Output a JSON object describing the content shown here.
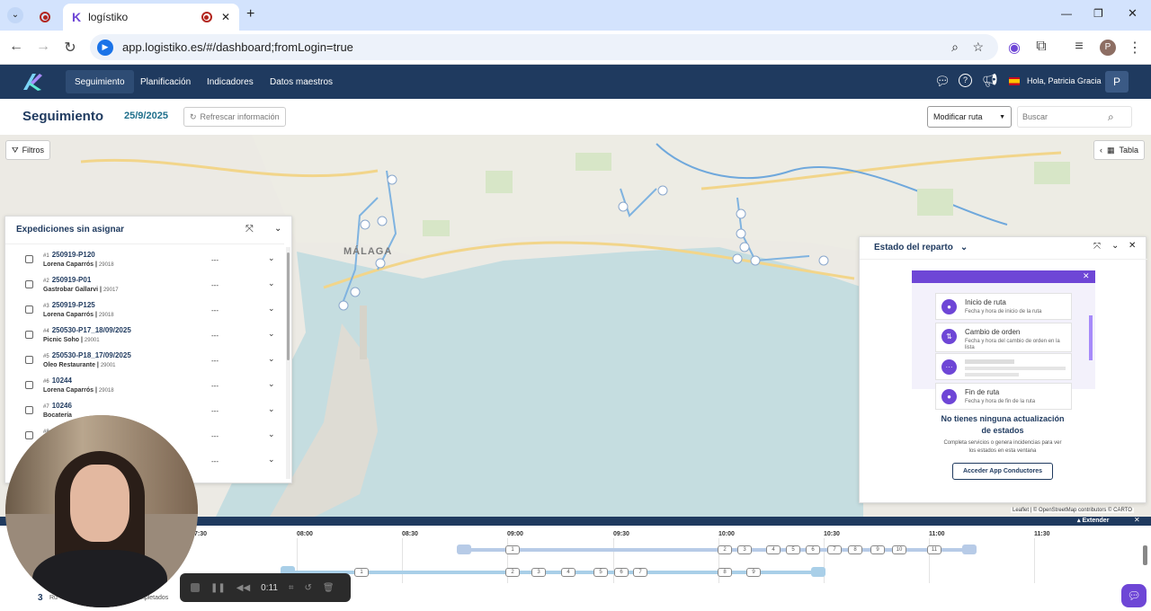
{
  "browser": {
    "tab_title": "logístiko",
    "url": "app.logistiko.es/#/dashboard;fromLogin=true"
  },
  "nav": {
    "items": [
      "Seguimiento",
      "Planificación",
      "Indicadores",
      "Datos maestros"
    ],
    "greeting": "Hola, Patricia Gracia",
    "avatar": "P"
  },
  "header": {
    "title": "Seguimiento",
    "date": "25/9/2025",
    "refresh_label": "Refrescar información",
    "route_select": "Modificar ruta",
    "search_placeholder": "Buscar"
  },
  "map": {
    "filters_label": "Filtros",
    "table_label": "Tabla",
    "city_label": "MÁLAGA",
    "attribution": "Leaflet | © OpenStreetMap contributors © CARTO"
  },
  "unassigned": {
    "title": "Expediciones sin asignar",
    "rows": [
      {
        "num": "#1",
        "code": "250919-P120",
        "name": "Lorena Caparrós",
        "zip": "29018",
        "value": "---"
      },
      {
        "num": "#2",
        "code": "250919-P01",
        "name": "Gastrobar Gallarvi",
        "zip": "29017",
        "value": "---"
      },
      {
        "num": "#3",
        "code": "250919-P125",
        "name": "Lorena Caparrós",
        "zip": "29018",
        "value": "---"
      },
      {
        "num": "#4",
        "code": "250530-P17_18/09/2025",
        "name": "Picnic Soho",
        "zip": "29001",
        "value": "---"
      },
      {
        "num": "#5",
        "code": "250530-P18_17/09/2025",
        "name": "Oleo Restaurante",
        "zip": "29001",
        "value": "---"
      },
      {
        "num": "#6",
        "code": "10244",
        "name": "Lorena Caparrós",
        "zip": "29018",
        "value": "---"
      },
      {
        "num": "#7",
        "code": "10246",
        "name": "Bocatería",
        "zip": "",
        "value": "---"
      },
      {
        "num": "#8",
        "code": "",
        "name": "",
        "zip": "",
        "value": "---"
      },
      {
        "num": "",
        "code": "",
        "name": "",
        "zip": "",
        "value": "---"
      }
    ]
  },
  "status_panel": {
    "title": "Estado del reparto",
    "states": [
      {
        "title": "Inicio de ruta",
        "desc": "Fecha y hora de inicio de la ruta"
      },
      {
        "title": "Cambio de orden",
        "desc": "Fecha y hora del cambio de orden en la lista"
      },
      {
        "title": "",
        "desc": ""
      },
      {
        "title": "Fin de ruta",
        "desc": "Fecha y hora de fin de la ruta"
      }
    ],
    "empty_title": "No tienes ninguna actualización de estados",
    "empty_desc": "Completa servicios o genera incidencias para ver los estados en esta ventana",
    "cta": "Acceder App Conductores"
  },
  "timeline": {
    "extend_label": "Extender",
    "ticks": [
      "7:30",
      "08:00",
      "08:30",
      "09:00",
      "09:30",
      "10:00",
      "10:30",
      "11:00",
      "11:30"
    ],
    "route1_stops": [
      "1",
      "2",
      "3",
      "4",
      "5",
      "6",
      "7",
      "8",
      "9",
      "10",
      "11"
    ],
    "route2_stops": [
      "1",
      "2",
      "3",
      "4",
      "5",
      "6",
      "7",
      "8",
      "9"
    ],
    "routes_count": "3",
    "routes_label": "Ru",
    "completed_label": "mpletados"
  },
  "recorder": {
    "time": "0:11"
  }
}
